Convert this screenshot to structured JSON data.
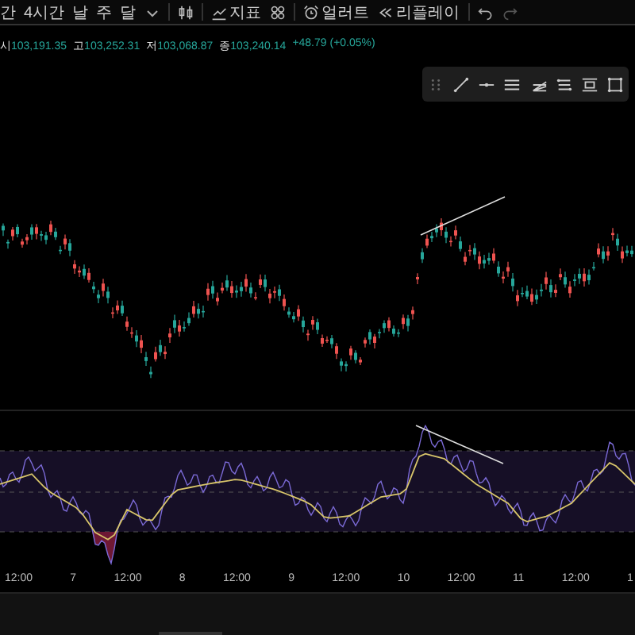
{
  "toolbar": {
    "timeframes": [
      "간",
      "4시간",
      "날",
      "주",
      "달"
    ],
    "indicators": "지표",
    "alert": "얼러트",
    "replay": "리플레이"
  },
  "ohlc": [
    {
      "label": "시",
      "value": "103,191.35"
    },
    {
      "label": "고",
      "value": "103,252.31"
    },
    {
      "label": "저",
      "value": "103,068.87"
    },
    {
      "label": "종",
      "value": "103,240.14"
    }
  ],
  "change": "+48.79 (+0.05%)",
  "time_axis": [
    "12:00",
    "7",
    "12:00",
    "8",
    "12:00",
    "9",
    "12:00",
    "10",
    "12:00",
    "11",
    "12:00",
    "1"
  ]
}
